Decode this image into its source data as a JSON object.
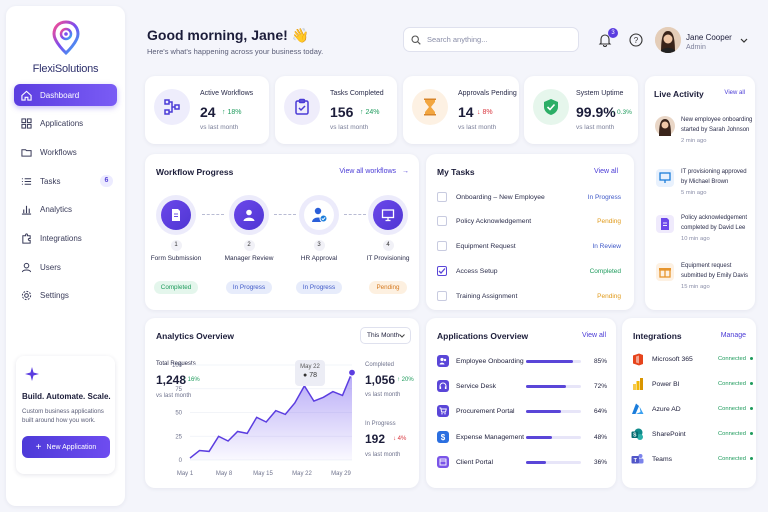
{
  "brand": {
    "name": "FlexiSolutions"
  },
  "sidebar": {
    "items": [
      {
        "label": "Dashboard",
        "icon": "home-icon"
      },
      {
        "label": "Applications",
        "icon": "grid-icon"
      },
      {
        "label": "Workflows",
        "icon": "folder-icon"
      },
      {
        "label": "Tasks",
        "icon": "list-icon",
        "badge": "6"
      },
      {
        "label": "Analytics",
        "icon": "bar-chart-icon"
      },
      {
        "label": "Integrations",
        "icon": "puzzle-icon"
      },
      {
        "label": "Users",
        "icon": "user-icon"
      },
      {
        "label": "Settings",
        "icon": "gear-icon"
      }
    ],
    "promo": {
      "title": "Build. Automate. Scale.",
      "desc": "Custom business applications built around how you work.",
      "button": "New Application"
    }
  },
  "header": {
    "greeting": "Good morning, Jane! 👋",
    "subtitle": "Here's what's happening across your business today.",
    "search_placeholder": "Search anything...",
    "notif_count": "3",
    "user": {
      "name": "Jane Cooper",
      "role": "Admin"
    }
  },
  "stats": [
    {
      "label": "Active Workflows",
      "value": "24",
      "delta": "↑ 18%",
      "dir": "up",
      "sub": "vs last month",
      "icon": "workflow-icon",
      "bg": "#eeedfc",
      "color": "#4a3bd6"
    },
    {
      "label": "Tasks Completed",
      "value": "156",
      "delta": "↑ 24%",
      "dir": "up",
      "sub": "vs last month",
      "icon": "clipboard-check-icon",
      "bg": "#efedfb",
      "color": "#4a3bd6"
    },
    {
      "label": "Approvals Pending",
      "value": "14",
      "delta": "↓ 8%",
      "dir": "down",
      "sub": "vs last month",
      "icon": "hourglass-icon",
      "bg": "#fdf1e3",
      "color": "#e6952d"
    },
    {
      "label": "System Uptime",
      "value": "99.9%",
      "delta": "↑ 0.3%",
      "dir": "up",
      "sub": "vs last month",
      "icon": "shield-check-icon",
      "bg": "#e6f6ec",
      "color": "#24a862"
    }
  ],
  "activity": {
    "title": "Live Activity",
    "link": "View all",
    "items": [
      {
        "text": "New employee onboarding started by Sarah Johnson",
        "time": "2 min ago",
        "icon": "avatar"
      },
      {
        "text": "IT provisioning approved by Michael Brown",
        "time": "5 min ago",
        "icon": "monitor-icon"
      },
      {
        "text": "Policy acknowledgement completed by David Lee",
        "time": "10 min ago",
        "icon": "document-icon"
      },
      {
        "text": "Equipment request submitted by Emily Davis",
        "time": "15 min ago",
        "icon": "gift-box-icon"
      }
    ]
  },
  "workflow": {
    "title": "Workflow Progress",
    "link": "View all workflows",
    "steps": [
      {
        "num": "1",
        "name": "Form Submission",
        "status": "Completed",
        "kind": "done",
        "icon": "document-icon"
      },
      {
        "num": "2",
        "name": "Manager Review",
        "status": "In Progress",
        "kind": "prog",
        "icon": "user-icon"
      },
      {
        "num": "3",
        "name": "HR Approval",
        "status": "In Progress",
        "kind": "prog",
        "icon": "user-check-icon"
      },
      {
        "num": "4",
        "name": "IT Provisioning",
        "status": "Pending",
        "kind": "pend",
        "icon": "monitor-icon"
      }
    ]
  },
  "tasks": {
    "title": "My Tasks",
    "link": "View all",
    "items": [
      {
        "name": "Onboarding – New Employee",
        "status": "In Progress",
        "kind": "s-prog",
        "checked": false
      },
      {
        "name": "Policy Acknowledgement",
        "status": "Pending",
        "kind": "s-pend",
        "checked": false
      },
      {
        "name": "Equipment Request",
        "status": "In Review",
        "kind": "s-rev",
        "checked": false
      },
      {
        "name": "Access Setup",
        "status": "Completed",
        "kind": "s-done",
        "checked": true
      },
      {
        "name": "Training Assignment",
        "status": "Pending",
        "kind": "s-pend",
        "checked": false
      }
    ]
  },
  "analytics": {
    "title": "Analytics Overview",
    "period": "This Month",
    "total_label": "Total Requests",
    "total_value": "1,248",
    "total_delta": "↑ 16%",
    "total_sub": "vs last month",
    "completed_label": "Completed",
    "completed_value": "1,056",
    "completed_delta": "↑ 20%",
    "completed_sub": "vs last month",
    "inprog_label": "In Progress",
    "inprog_value": "192",
    "inprog_delta": "↓ 4%",
    "inprog_sub": "vs last month",
    "tooltip_date": "May 22",
    "tooltip_value": "● 78"
  },
  "chart_data": {
    "type": "area",
    "x": [
      "May 1",
      "May 3",
      "May 5",
      "May 7",
      "May 8",
      "May 10",
      "May 12",
      "May 14",
      "May 15",
      "May 17",
      "May 19",
      "May 21",
      "May 22",
      "May 24",
      "May 26",
      "May 28",
      "May 29",
      "May 31"
    ],
    "values": [
      2,
      10,
      9,
      25,
      20,
      30,
      28,
      45,
      40,
      52,
      48,
      60,
      78,
      62,
      66,
      72,
      68,
      92
    ],
    "xticks": [
      "May 1",
      "May 8",
      "May 15",
      "May 22",
      "May 29"
    ],
    "yticks": [
      "0",
      "25",
      "50",
      "75",
      "100"
    ],
    "ylim": [
      0,
      100
    ]
  },
  "apps": {
    "title": "Applications Overview",
    "link": "View all",
    "items": [
      {
        "name": "Employee Onboarding",
        "pct": "85%",
        "value": 85,
        "icon": "people-icon"
      },
      {
        "name": "Service Desk",
        "pct": "72%",
        "value": 72,
        "icon": "headset-icon"
      },
      {
        "name": "Procurement Portal",
        "pct": "64%",
        "value": 64,
        "icon": "cart-icon"
      },
      {
        "name": "Expense Management",
        "pct": "48%",
        "value": 48,
        "icon": "dollar-icon"
      },
      {
        "name": "Client Portal",
        "pct": "36%",
        "value": 36,
        "icon": "portal-icon"
      }
    ]
  },
  "integrations": {
    "title": "Integrations",
    "link": "Manage",
    "items": [
      {
        "name": "Microsoft 365",
        "status": "Connected",
        "icon": "office-icon",
        "color": "#e6441c"
      },
      {
        "name": "Power BI",
        "status": "Connected",
        "icon": "powerbi-icon",
        "color": "#f2b705"
      },
      {
        "name": "Azure AD",
        "status": "Connected",
        "icon": "azure-icon",
        "color": "#1b7ddb"
      },
      {
        "name": "SharePoint",
        "status": "Connected",
        "icon": "sharepoint-icon",
        "color": "#0e8a8a"
      },
      {
        "name": "Teams",
        "status": "Connected",
        "icon": "teams-icon",
        "color": "#5156c8"
      }
    ]
  }
}
